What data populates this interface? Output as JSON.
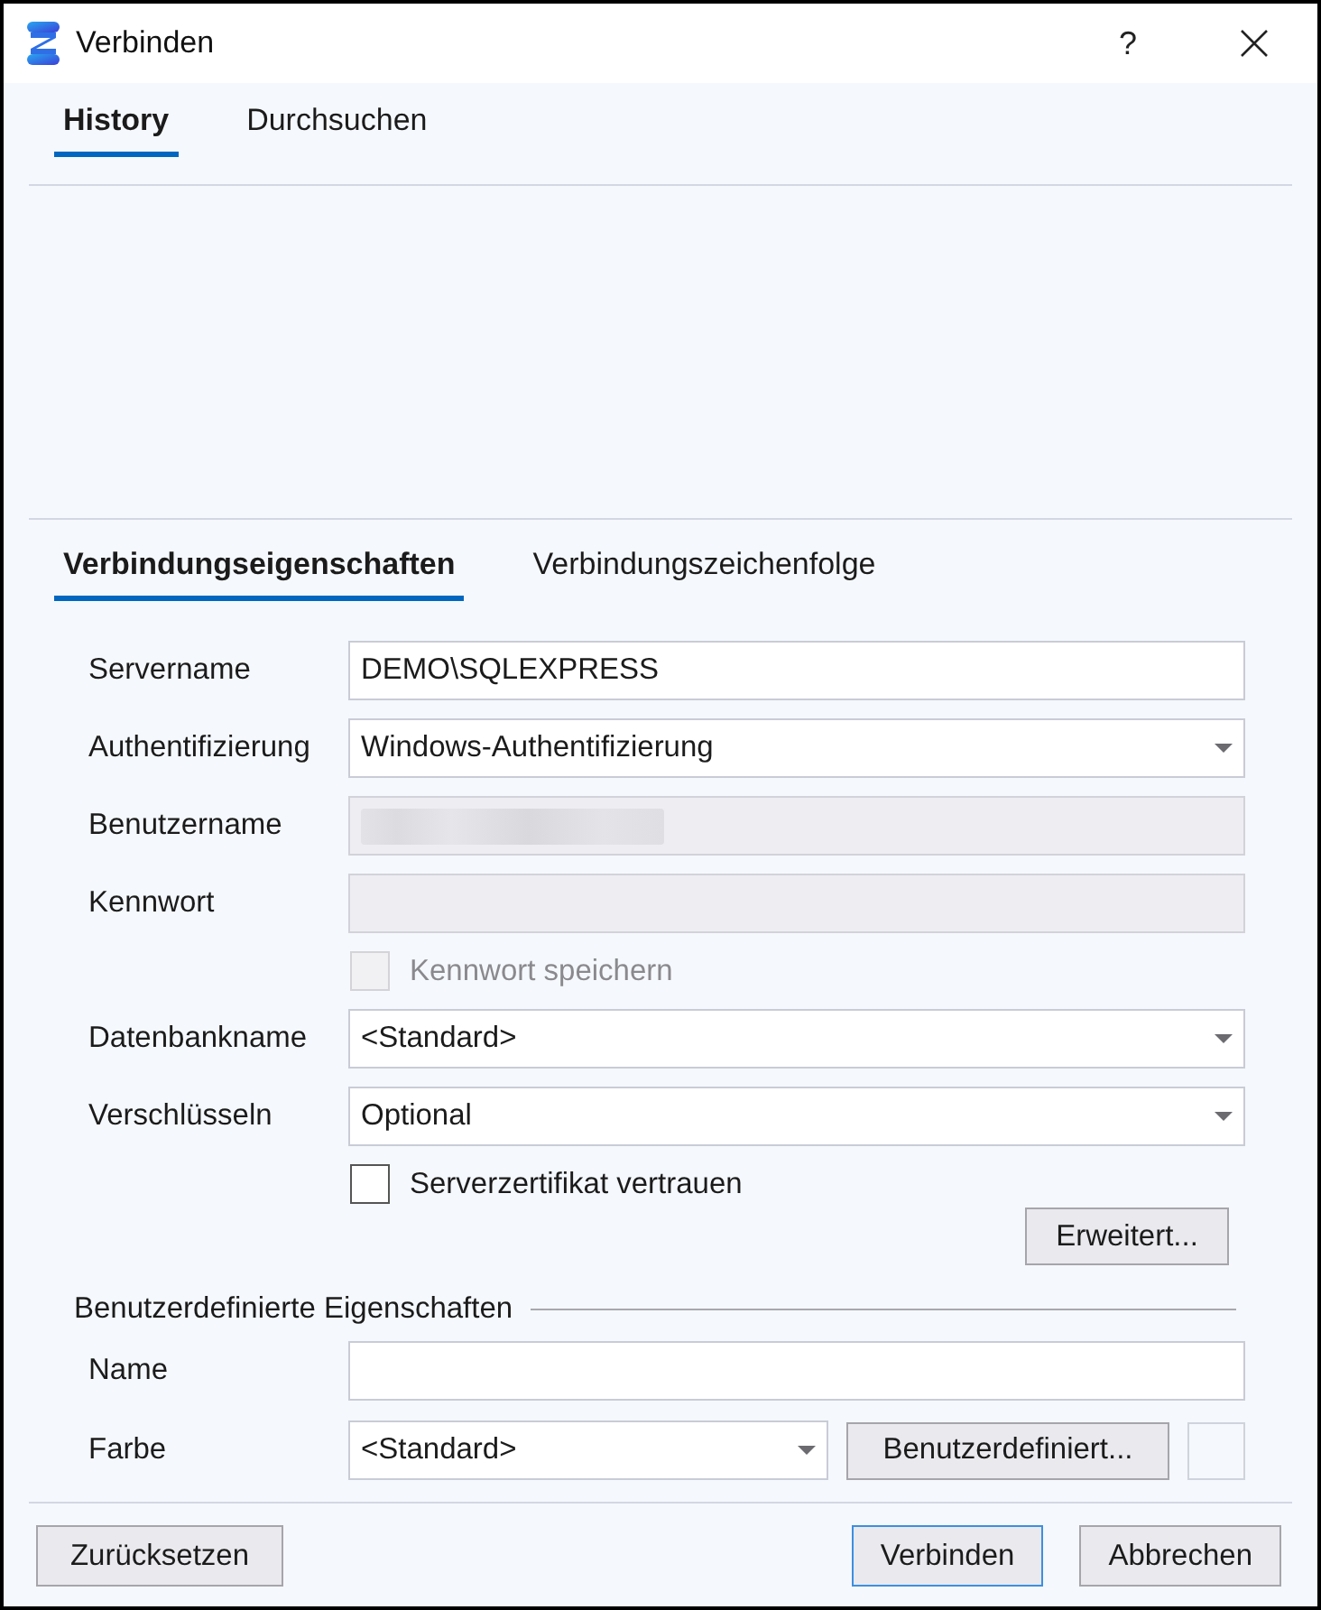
{
  "window": {
    "title": "Verbinden",
    "help": "?"
  },
  "top_tabs": [
    {
      "label": "History",
      "selected": true
    },
    {
      "label": "Durchsuchen",
      "selected": false
    }
  ],
  "property_tabs": [
    {
      "label": "Verbindungseigenschaften",
      "selected": true
    },
    {
      "label": "Verbindungszeichenfolge",
      "selected": false
    }
  ],
  "form": {
    "rows": [
      {
        "kind": "text",
        "label": "Servername",
        "value": "DEMO\\SQLEXPRESS",
        "disabled": false
      },
      {
        "kind": "dropdown",
        "label": "Authentifizierung",
        "value": "Windows-Authentifizierung",
        "disabled": false
      },
      {
        "kind": "text",
        "label": "Benutzername",
        "disabled": true,
        "redacted": true
      },
      {
        "kind": "text",
        "label": "Kennwort",
        "disabled": true
      },
      {
        "kind": "checkbox",
        "label": "Kennwort speichern",
        "checked": false,
        "disabled": true
      },
      {
        "kind": "dropdown",
        "label": "Datenbankname",
        "value": "<Standard>",
        "disabled": false
      },
      {
        "kind": "dropdown",
        "label": "Verschlüsseln",
        "value": "Optional",
        "disabled": false
      },
      {
        "kind": "checkbox",
        "label": "Serverzertifikat vertrauen",
        "checked": false,
        "disabled": false
      }
    ],
    "advanced_button": "Erweitert..."
  },
  "custom_properties": {
    "title": "Benutzerdefinierte Eigenschaften",
    "name": {
      "label": "Name"
    },
    "color": {
      "label": "Farbe",
      "value": "<Standard>",
      "button": "Benutzerdefiniert..."
    }
  },
  "footer": {
    "left_buttons": [
      {
        "label": "Zurücksetzen",
        "default": false
      }
    ],
    "right_buttons": [
      {
        "label": "Verbinden",
        "default": true
      },
      {
        "label": "Abbrechen",
        "default": false
      }
    ]
  }
}
